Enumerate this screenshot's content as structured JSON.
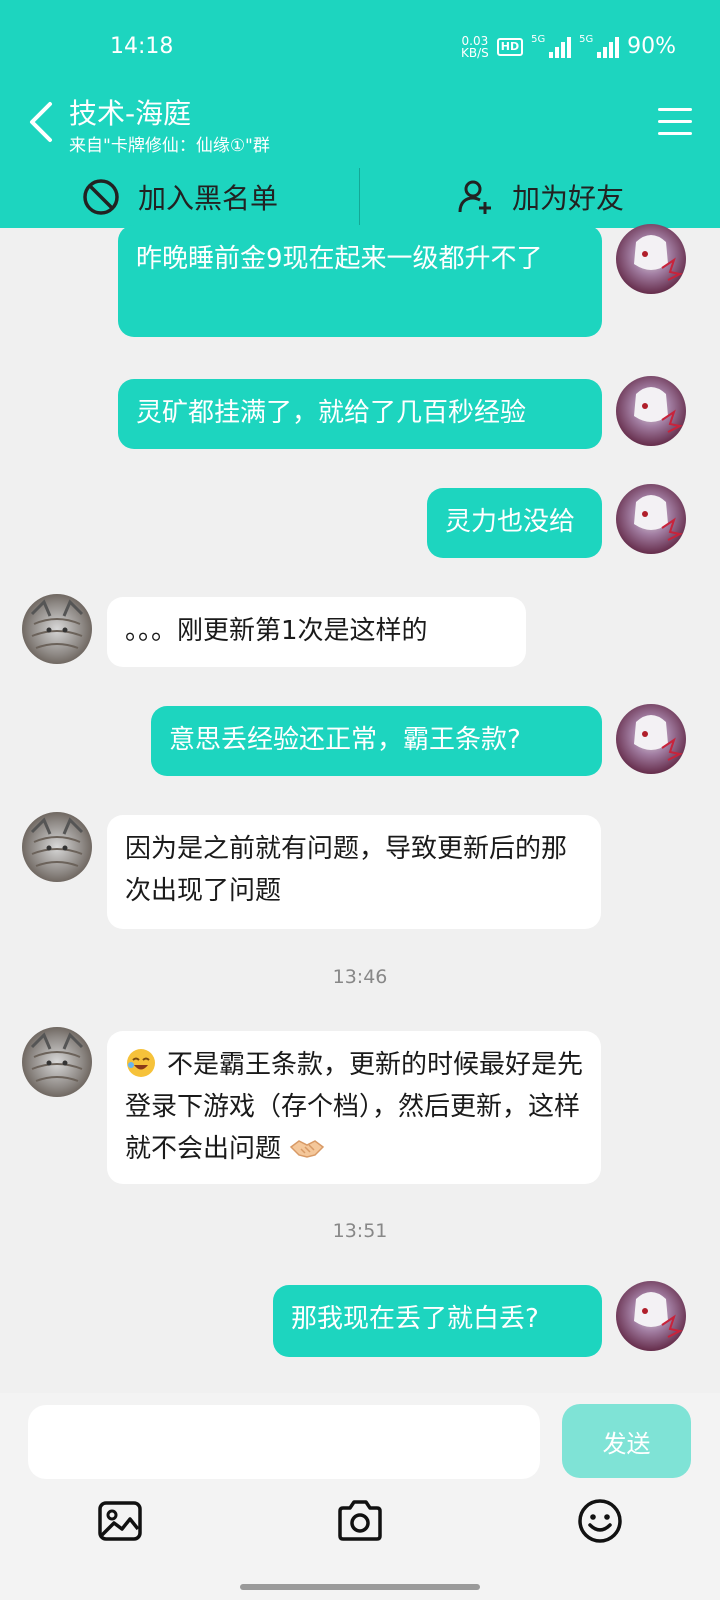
{
  "status_bar": {
    "time": "14:18",
    "net_speed_value": "0.03",
    "net_speed_unit": "KB/S",
    "hd": "HD",
    "signal1": "5G",
    "signal2": "5G",
    "battery": "90%"
  },
  "header": {
    "title": "技术-海庭",
    "subtitle": "来自\"卡牌修仙：仙缘①\"群",
    "block_label": "加入黑名单",
    "add_friend_label": "加为好友"
  },
  "messages": [
    {
      "side": "me",
      "text": "昨晚睡前金9现在起来一级都升不了"
    },
    {
      "side": "me",
      "text": "灵矿都挂满了，就给了几百秒经验"
    },
    {
      "side": "me",
      "text": "灵力也没给"
    },
    {
      "side": "them",
      "text": "。。。刚更新第1次是这样的"
    },
    {
      "side": "me",
      "text": "意思丢经验还正常，霸王条款?"
    },
    {
      "side": "them",
      "text": "因为是之前就有问题，导致更新后的那次出现了问题"
    },
    {
      "side": "time",
      "text": "13:46"
    },
    {
      "side": "them",
      "text": "不是霸王条款，更新的时候最好是先登录下游戏（存个档），然后更新，这样就不会出问题"
    },
    {
      "side": "time",
      "text": "13:51"
    },
    {
      "side": "me",
      "text": "那我现在丢了就白丢?"
    }
  ],
  "composer": {
    "input_value": "",
    "send_label": "发送"
  },
  "colors": {
    "accent": "#1dd5bf",
    "send_disabled": "#7fe3d6",
    "background": "#f0f0f0"
  },
  "icons": [
    "back-arrow-icon",
    "menu-icon",
    "block-icon",
    "add-user-icon",
    "image-icon",
    "camera-icon",
    "smiley-icon"
  ]
}
